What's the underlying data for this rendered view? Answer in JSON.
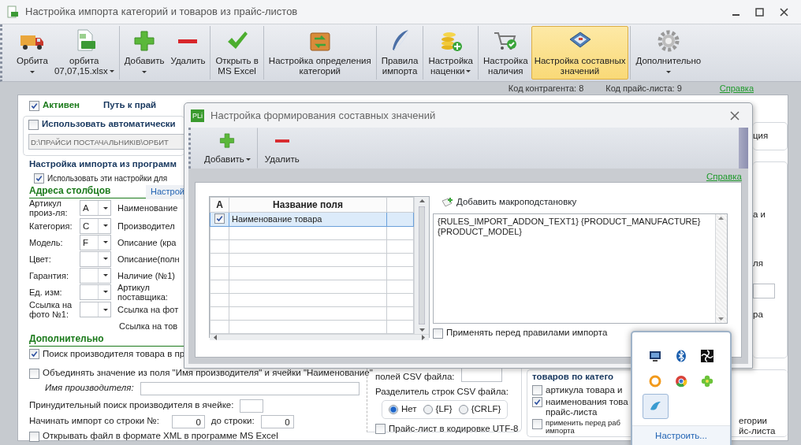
{
  "window": {
    "title": "Настройка импорта категорий и товаров из прайс-листов"
  },
  "toolbar": [
    [
      {
        "kind": "truck",
        "label": [
          "Орбита"
        ],
        "dropdown": true,
        "selected": false
      },
      {
        "kind": "xls",
        "label": [
          "орбита",
          "07,07,15.xlsx"
        ],
        "dropdown": true,
        "selected": false
      }
    ],
    [
      {
        "kind": "plus",
        "label": [
          "Добавить"
        ],
        "dropdown": true,
        "selected": false
      },
      {
        "kind": "minus",
        "label": [
          "Удалить"
        ],
        "dropdown": false,
        "selected": false
      }
    ],
    [
      {
        "kind": "check",
        "label": [
          "Открыть в",
          "MS Excel"
        ],
        "dropdown": false,
        "selected": false
      }
    ],
    [
      {
        "kind": "box",
        "label": [
          "Настройка определения",
          "категорий"
        ],
        "dropdown": false,
        "selected": false
      }
    ],
    [
      {
        "kind": "feather",
        "label": [
          "Правила",
          "импорта"
        ],
        "dropdown": false,
        "selected": false
      }
    ],
    [
      {
        "kind": "coins",
        "label": [
          "Настройка",
          "наценки"
        ],
        "dropdown": true,
        "selected": false
      }
    ],
    [
      {
        "kind": "cart",
        "label": [
          "Настройка",
          "наличия"
        ],
        "dropdown": false,
        "selected": false
      },
      {
        "kind": "case",
        "label": [
          "Настройка составных",
          "значений"
        ],
        "dropdown": false,
        "selected": true
      }
    ],
    [
      {
        "kind": "gear",
        "label": [
          "Дополнительно"
        ],
        "dropdown": true,
        "selected": false
      }
    ]
  ],
  "info": {
    "contractor_code": "Код контрагента: 8",
    "price_list_code": "Код прайс-листа: 9",
    "help_link": "Справка"
  },
  "form": {
    "active": {
      "label": "Активен",
      "checked": true
    },
    "path_label": "Путь к прай",
    "auto": {
      "label": "Использовать автоматически",
      "checked": false
    },
    "path_value": "D:\\ПРАЙСИ ПОСТАЧАЛЬНИКІВ\\ОРБИТ",
    "import_group_title": "Настройка импорта из программ",
    "use_settings": {
      "label": "Использовать эти настройки для",
      "checked": true
    },
    "columns_heading": "Адреса столбцов",
    "settings_tab": "Настрой",
    "column_fields": [
      {
        "label": "Артикул произ-ля:",
        "value": "A"
      },
      {
        "label": "Категория:",
        "value": "C"
      },
      {
        "label": "Модель:",
        "value": "F"
      },
      {
        "label": "Цвет:"
      },
      {
        "label": "Гарантия:"
      },
      {
        "label": "Ед. изм:"
      },
      {
        "label": "Ссылка на фото №1:"
      }
    ],
    "column_labels_right": [
      "Наименование",
      "Производител",
      "Описание (кра",
      "Описание(полн",
      "Наличие (№1)",
      "Артикул поставщика:",
      "Ссылка на фот",
      "Ссылка на тов"
    ],
    "extra_heading": "Дополнительно",
    "extra_options": [
      {
        "label": "Поиск производителя товара в пр",
        "checked": true
      },
      {
        "label": "Объединять значение из поля \"Имя производителя\" и ячейки \"Наименование\"",
        "checked": false
      }
    ],
    "manufacturer_name_label": "Имя производителя:",
    "forced_search_label": "Принудительный поиск производителя в ячейке:",
    "start_row_label": "Начинать импорт со строки №:",
    "start_row_value": "0",
    "end_row_label": "до строки:",
    "end_row_value": "0",
    "open_xml": {
      "label": "Открывать файл в формате XML в программе MS Excel",
      "checked": false
    },
    "csv": {
      "fields_label": "полей CSV файла:",
      "rows_label": "Разделитель строк CSV файла:",
      "separators": [
        {
          "label": "Нет",
          "selected": true
        },
        {
          "label": "{LF}",
          "selected": false
        },
        {
          "label": "{CRLF}",
          "selected": false
        }
      ],
      "utf8": {
        "label": "Прайс-лист в кодировке UTF-8",
        "checked": false
      }
    },
    "auto_group": {
      "title": "товаров по катего",
      "options": [
        {
          "lines": [
            "артикула товара и"
          ],
          "checked": false,
          "small": false
        },
        {
          "lines": [
            "наименования това",
            "прайс-листа"
          ],
          "checked": true,
          "small": false
        },
        {
          "lines": [
            "применить перед раб",
            "импорта"
          ],
          "checked": false,
          "small": true
        }
      ],
      "fragments": [
        "егории",
        "йс-листа"
      ]
    },
    "right_fragments": {
      "top": "ция",
      "middle": [
        "а и",
        "ля"
      ],
      "bottom": "ра"
    }
  },
  "dialog": {
    "logo": "PLi",
    "title": "Настройка формирования составных значений",
    "toolbar": [
      {
        "kind": "plus",
        "label": "Добавить",
        "dropdown": true
      },
      {
        "kind": "minus",
        "label": "Удалить",
        "dropdown": false
      }
    ],
    "help_link": "Справка",
    "grid": {
      "columns": [
        "A",
        "Название поля"
      ],
      "rows": [
        {
          "checked": true,
          "name": "Наименование товара",
          "selected": true
        }
      ]
    },
    "add_macro": "Добавить макроподстановку",
    "expression": "{RULES_IMPORT_ADDON_TEXT1} {PRODUCT_MANUFACTURE} {PRODUCT_MODEL}",
    "apply_before": {
      "label": "Применять перед правилами импорта",
      "checked": false
    }
  },
  "tray": {
    "icons": [
      {
        "kind": "monitor",
        "selected": false
      },
      {
        "kind": "bluetooth",
        "selected": false
      },
      {
        "kind": "aperture",
        "selected": false
      },
      {
        "kind": "ring",
        "selected": false
      },
      {
        "kind": "chrome",
        "selected": false
      },
      {
        "kind": "clover",
        "selected": false
      },
      {
        "kind": "bird",
        "selected": true
      }
    ],
    "link": "Настроить..."
  }
}
